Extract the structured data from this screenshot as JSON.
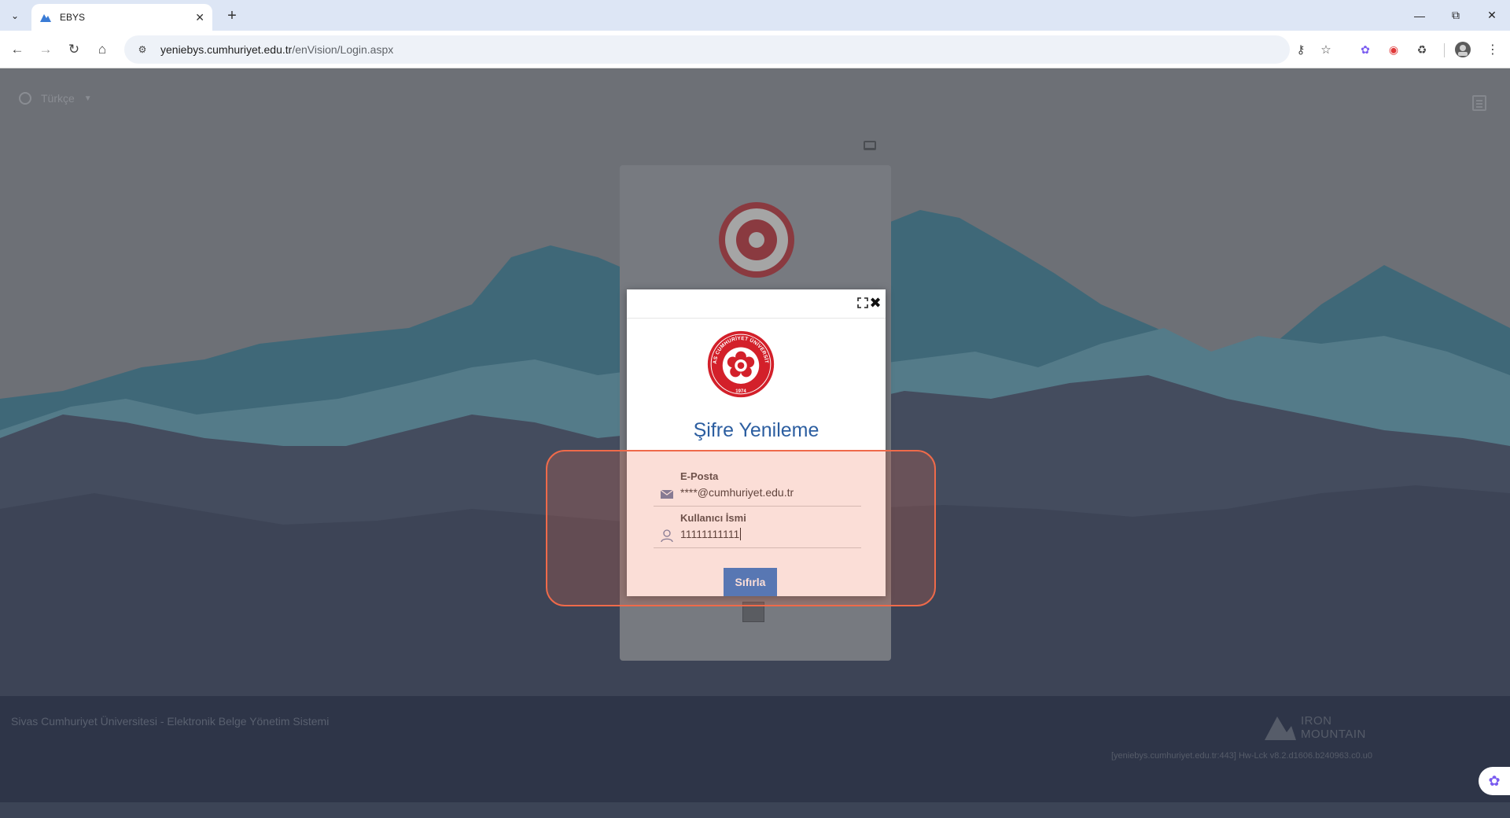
{
  "browser": {
    "tab_title": "EBYS",
    "url_host": "yeniebys.cumhuriyet.edu.tr",
    "url_path": "/enVision/Login.aspx"
  },
  "page": {
    "language": "Türkçe",
    "footer_text": "Sivas Cumhuriyet Üniversitesi - Elektronik Belge Yönetim Sistemi",
    "brand_line1": "IRON",
    "brand_line2": "MOUNTAIN",
    "version_text": "[yeniebys.cumhuriyet.edu.tr:443] Hw-Lck v8.2.d1606.b240963.c0.u0"
  },
  "modal": {
    "title": "Şifre Yenileme",
    "email_label": "E-Posta",
    "email_value": "****@cumhuriyet.edu.tr",
    "username_label": "Kullanıcı İsmi",
    "username_value": "11111111111",
    "reset_button": "Sıfırla"
  },
  "seal": {
    "text": "SİVAS CUMHURİYET ÜNİVERSİTESİ",
    "year": "1974"
  },
  "colors": {
    "accent_blue": "#2f7bd1",
    "title_blue": "#2c5ea0",
    "highlight": "#ef6a4a",
    "seal_red": "#d3202a"
  }
}
